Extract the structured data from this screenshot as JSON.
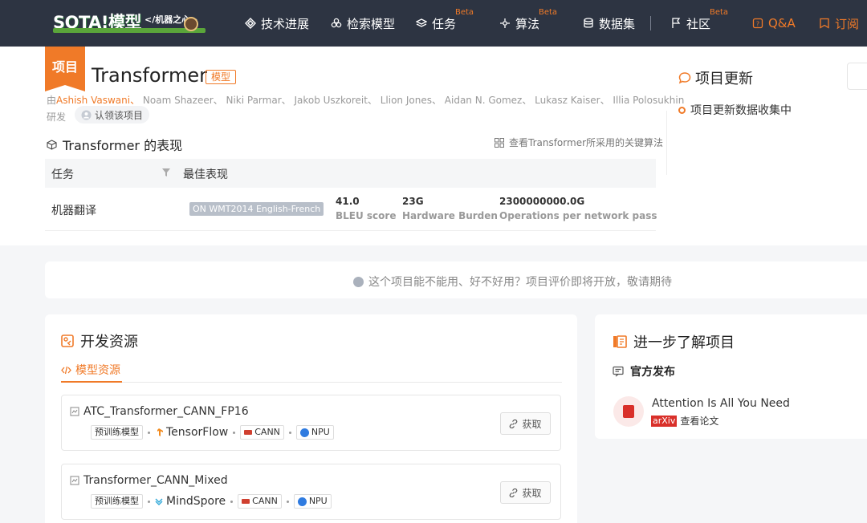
{
  "nav": {
    "logo_main": "SOTA!模型",
    "logo_sub": "</机器之心>",
    "items": [
      {
        "label": "技术进展"
      },
      {
        "label": "检索模型"
      },
      {
        "label": "任务",
        "badge": "Beta"
      },
      {
        "label": "算法",
        "badge": "Beta"
      },
      {
        "label": "数据集"
      },
      {
        "label": "社区",
        "badge": "Beta"
      },
      {
        "label": "Q&A"
      },
      {
        "label": "订阅"
      }
    ]
  },
  "project": {
    "tag": "项目",
    "title": "Transformer",
    "badge": "模型",
    "authors_prefix": "由",
    "first_author": "Ashish Vaswani、",
    "other_authors": " Noam Shazeer、 Niki Parmar、 Jakob Uszkoreit、 Llion Jones、 Aidan N. Gomez、 Lukasz Kaiser、 Illia Polosukhin",
    "authors_suffix": "研发",
    "claim_label": "认领该项目"
  },
  "performance": {
    "heading": "Transformer 的表现",
    "algo_link": "查看Transformer所采用的关键算法",
    "col_task": "任务",
    "col_best": "最佳表现",
    "rows": [
      {
        "task": "机器翻译",
        "dataset": "ON WMT2014 English-French",
        "metrics": [
          {
            "value": "41.0",
            "label": "BLEU score"
          },
          {
            "value": "23G",
            "label": "Hardware Burden"
          },
          {
            "value": "2300000000.0G",
            "label": "Operations per network pass"
          }
        ]
      }
    ]
  },
  "updates": {
    "title": "项目更新",
    "item": "项目更新数据收集中"
  },
  "eval_banner": "这个项目能不能用、好不好用？项目评价即将开放，敬请期待",
  "dev": {
    "title": "开发资源",
    "tab": "模型资源",
    "resources": [
      {
        "name": "ATC_Transformer_CANN_FP16",
        "type_tag": "预训练模型",
        "framework": "TensorFlow",
        "platform": "CANN",
        "device": "NPU",
        "button": "获取"
      },
      {
        "name": "Transformer_CANN_Mixed",
        "type_tag": "预训练模型",
        "framework": "MindSpore",
        "platform": "CANN",
        "device": "NPU",
        "button": "获取"
      }
    ]
  },
  "learn": {
    "title": "进一步了解项目",
    "official": "官方发布",
    "paper_title": "Attention Is All You Need",
    "paper_source": "arXiv",
    "paper_action": "查看论文"
  },
  "colors": {
    "accent": "#f07a28",
    "nav_bg": "#2d3442",
    "arxiv_red": "#d9302a"
  }
}
